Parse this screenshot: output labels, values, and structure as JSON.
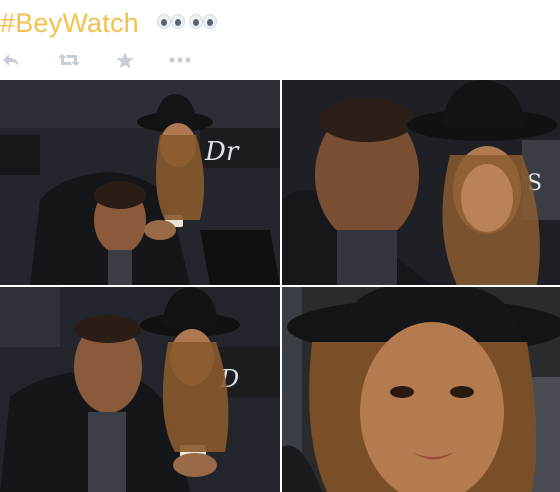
{
  "tweet": {
    "hashtag": "#BeyWatch",
    "emoji_icon": "eyes-emoji"
  },
  "actions": [
    {
      "name": "reply-icon"
    },
    {
      "name": "retweet-icon"
    },
    {
      "name": "favorite-star-icon"
    },
    {
      "name": "more-icon"
    }
  ],
  "colors": {
    "hashtag": "#f2c14e",
    "action_icons": "#c7cdd4",
    "background": "#ffffff"
  },
  "media": {
    "photos": [
      {
        "name": "photo-courtside-wide"
      },
      {
        "name": "photo-courtside-closeup"
      },
      {
        "name": "photo-courtside-medium"
      },
      {
        "name": "photo-hat-closeup"
      }
    ]
  }
}
